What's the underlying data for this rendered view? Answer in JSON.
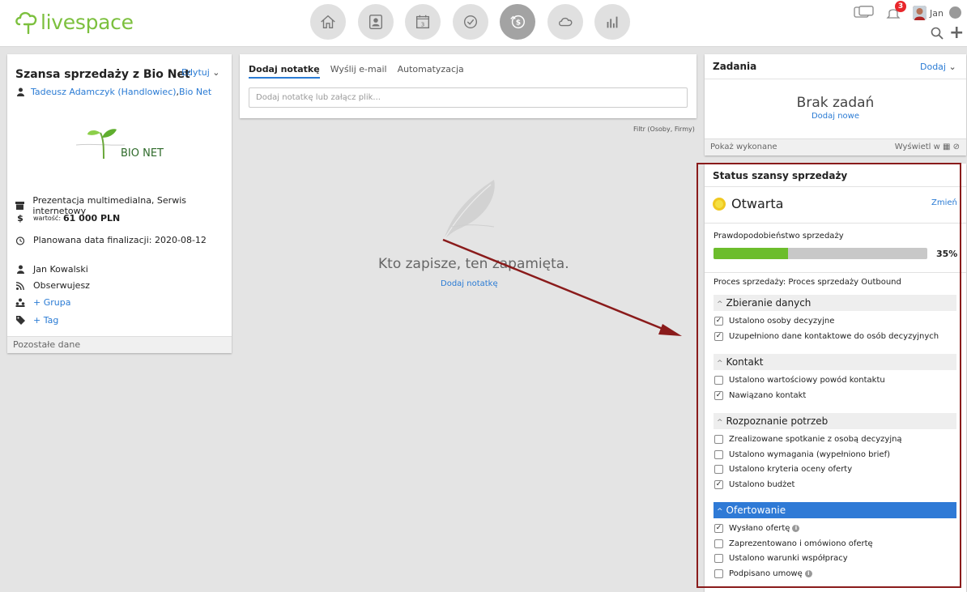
{
  "header": {
    "logo_text": "livespace",
    "nav_icons": [
      "home-icon",
      "contacts-icon",
      "calendar-icon",
      "tasks-icon",
      "deals-icon",
      "cloud-icon",
      "reports-icon"
    ],
    "calendar_day": "3",
    "notification_count": "3",
    "user_name": "Jan"
  },
  "deal": {
    "title": "Szansa sprzedaży z Bio Net",
    "edit_label": "Edytuj",
    "owner_link": "Tadeusz Adamczyk (Handlowiec)",
    "separator": ", ",
    "company_link": "Bio Net",
    "company_logo_text": "BIO NET",
    "products": "Prezentacja multimedialna, Serwis internetowy",
    "value_label": "wartość:",
    "value": "61 000 PLN",
    "close_date_label": "Planowana data finalizacji:",
    "close_date": "2020-08-12",
    "contact": "Jan Kowalski",
    "following": "Obserwujesz",
    "add_group": "+ Grupa",
    "add_tag": "+ Tag",
    "more_data": "Pozostałe dane"
  },
  "notes": {
    "tabs": [
      {
        "label": "Dodaj notatkę",
        "active": true
      },
      {
        "label": "Wyślij e-mail",
        "active": false
      },
      {
        "label": "Automatyzacja",
        "active": false
      }
    ],
    "input_placeholder": "Dodaj notatkę lub załącz plik...",
    "filter": "Filtr (Osoby, Firmy)",
    "empty_text": "Kto zapisze, ten zapamięta.",
    "empty_link": "Dodaj notatkę"
  },
  "tasks": {
    "title": "Zadania",
    "add_label": "Dodaj",
    "empty_title": "Brak zadań",
    "add_new": "Dodaj nowe",
    "show_done": "Pokaż wykonane",
    "show_in": "Wyświetl w"
  },
  "status": {
    "title": "Status szansy sprzedaży",
    "current": "Otwarta",
    "change_label": "Zmień",
    "probability_label": "Prawdopodobieństwo sprzedaży",
    "probability_value": "35%",
    "probability": 0.35,
    "process_label": "Proces sprzedaży: Proces sprzedaży Outbound",
    "stages": [
      {
        "name": "Zbieranie danych",
        "active": false,
        "items": [
          {
            "label": "Ustalono osoby decyzyjne",
            "checked": true,
            "info": false
          },
          {
            "label": "Uzupełniono dane kontaktowe do osób decyzyjnych",
            "checked": true,
            "info": false
          }
        ]
      },
      {
        "name": "Kontakt",
        "active": false,
        "items": [
          {
            "label": "Ustalono wartościowy powód kontaktu",
            "checked": false,
            "info": false
          },
          {
            "label": "Nawiązano kontakt",
            "checked": true,
            "info": false
          }
        ]
      },
      {
        "name": "Rozpoznanie potrzeb",
        "active": false,
        "items": [
          {
            "label": "Zrealizowane spotkanie z osobą decyzyjną",
            "checked": false,
            "info": false
          },
          {
            "label": "Ustalono wymagania (wypełniono brief)",
            "checked": false,
            "info": false
          },
          {
            "label": "Ustalono kryteria oceny oferty",
            "checked": false,
            "info": false
          },
          {
            "label": "Ustalono budżet",
            "checked": true,
            "info": false
          }
        ]
      },
      {
        "name": "Ofertowanie",
        "active": true,
        "items": [
          {
            "label": "Wysłano ofertę",
            "checked": true,
            "info": true
          },
          {
            "label": "Zaprezentowano i omówiono ofertę",
            "checked": false,
            "info": false
          },
          {
            "label": "Ustalono warunki współpracy",
            "checked": false,
            "info": false
          },
          {
            "label": "Podpisano umowę",
            "checked": false,
            "info": true
          }
        ]
      }
    ]
  },
  "colors": {
    "accent": "#2a7bd4",
    "brand_green": "#7cc03e",
    "progress_fill": "#6cbd2c",
    "highlight_border": "#8a1b1b",
    "active_stage": "#2f7ad6"
  }
}
